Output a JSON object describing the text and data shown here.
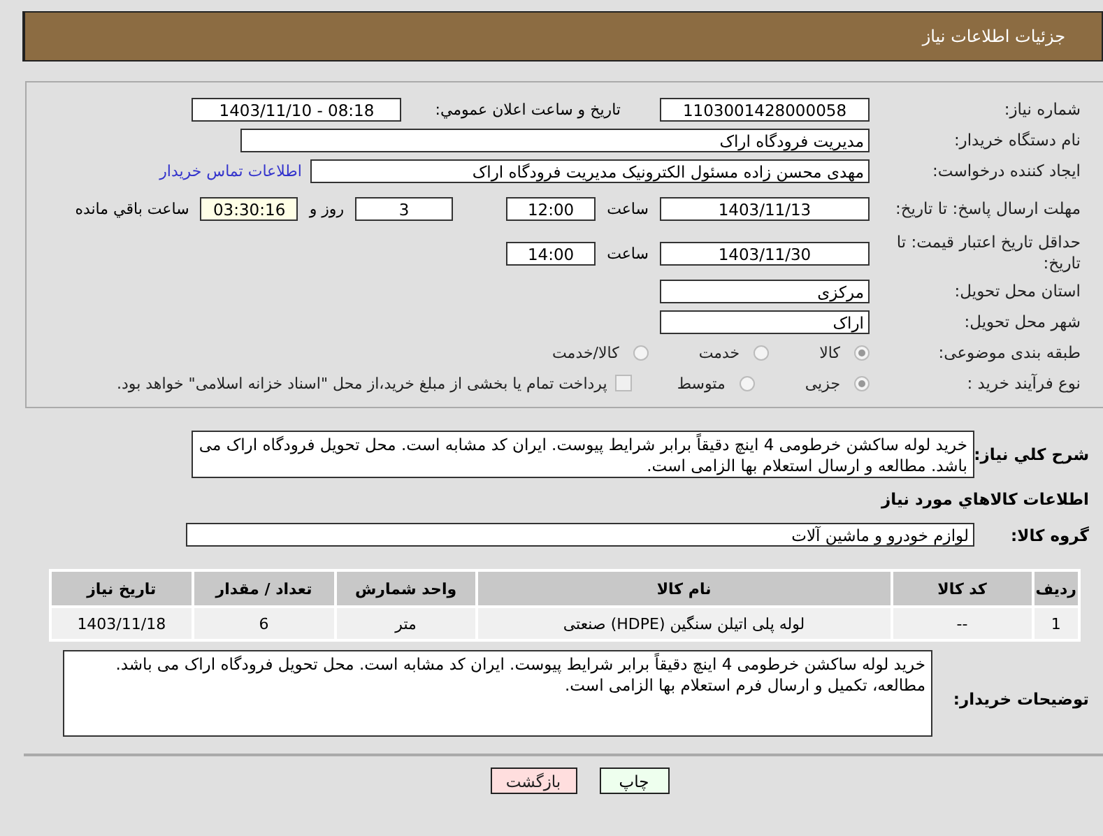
{
  "header": {
    "title": "جزئیات اطلاعات نیاز"
  },
  "need_number": {
    "label": "شماره نیاز:",
    "value": "1103001428000058"
  },
  "announce": {
    "label": "تاریخ و ساعت اعلان عمومي:",
    "value": "1403/11/10 - 08:18"
  },
  "buyer_org": {
    "label": "نام دستگاه خریدار:",
    "value": "مدیریت فرودگاه اراک"
  },
  "requester": {
    "label": "ایجاد کننده درخواست:",
    "value": "مهدی محسن زاده مسئول الکترونیک مدیریت فرودگاه اراک",
    "link": "اطلاعات تماس خریدار"
  },
  "reply_deadline": {
    "label": "مهلت ارسال پاسخ: تا تاریخ:",
    "date": "1403/11/13",
    "time_label": "ساعت",
    "time": "12:00",
    "days": "3",
    "days_label": "روز و",
    "remaining": "03:30:16",
    "remaining_label": "ساعت باقي مانده"
  },
  "price_validity": {
    "label": "حداقل تاریخ اعتبار قیمت: تا تاریخ:",
    "date": "1403/11/30",
    "time_label": "ساعت",
    "time": "14:00"
  },
  "province": {
    "label": "استان محل تحویل:",
    "value": "مرکزی"
  },
  "city": {
    "label": "شهر محل تحویل:",
    "value": "اراک"
  },
  "category": {
    "label": "طبقه بندی موضوعی:",
    "options": [
      {
        "label": "کالا",
        "selected": true
      },
      {
        "label": "خدمت",
        "selected": false
      },
      {
        "label": "کالا/خدمت",
        "selected": false
      }
    ]
  },
  "process": {
    "label": "نوع فرآیند خرید :",
    "options": [
      {
        "label": "جزیی",
        "selected": true
      },
      {
        "label": "متوسط",
        "selected": false
      }
    ],
    "payment_option": {
      "label": "پرداخت تمام یا بخشی از مبلغ خرید،از محل \"اسناد خزانه اسلامی\" خواهد بود.",
      "checked": false
    }
  },
  "summary": {
    "label": "شرح کلي نیاز:",
    "value": "خرید لوله ساکشن خرطومی 4 اینچ دقیقاً برابر شرایط پیوست. ایران کد مشابه است. محل تحویل فرودگاه اراک می باشد. مطالعه و ارسال استعلام بها الزامی است."
  },
  "goods_heading": "اطلاعات کالاهاي مورد نیاز",
  "goods_group": {
    "label": "گروه کالا:",
    "value": "لوازم خودرو و ماشین آلات"
  },
  "table": {
    "columns": [
      "ردیف",
      "کد کالا",
      "نام کالا",
      "واحد شمارش",
      "تعداد / مقدار",
      "تاریخ نیاز"
    ],
    "rows": [
      [
        "1",
        "--",
        "لوله پلی اتیلن سنگین (HDPE) صنعتی",
        "متر",
        "6",
        "1403/11/18"
      ]
    ]
  },
  "buyer_notes": {
    "label": "توضیحات خریدار:",
    "value": "خرید لوله ساکشن خرطومی 4 اینچ دقیقاً برابر شرایط پیوست. ایران کد مشابه است. محل تحویل فرودگاه اراک می باشد.\nمطالعه، تکمیل و ارسال فرم استعلام بها الزامی است."
  },
  "buttons": [
    {
      "label": "چاپ",
      "kind": "print"
    },
    {
      "label": "بازگشت",
      "kind": "back"
    }
  ]
}
